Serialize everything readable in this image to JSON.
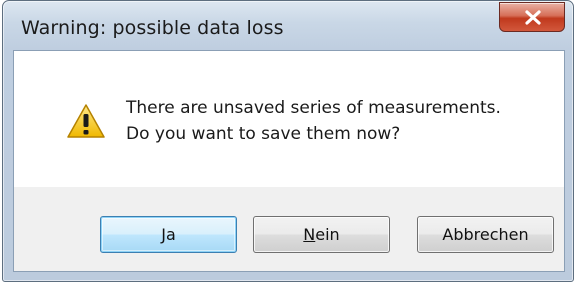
{
  "window": {
    "title": "Warning: possible data loss",
    "close_symbol": "x"
  },
  "dialog": {
    "icon": "warning-icon",
    "message_line1": "There are unsaved series of measurements.",
    "message_line2": "Do you want to save them now?"
  },
  "buttons": {
    "yes_label": "Ja",
    "no_label_mnemonic": "N",
    "no_label_rest": "ein",
    "cancel_label": "Abbrechen"
  },
  "colors": {
    "close_button": "#c74a30",
    "warning_icon": "#f5c400",
    "default_button_border": "#3c7fb1"
  }
}
